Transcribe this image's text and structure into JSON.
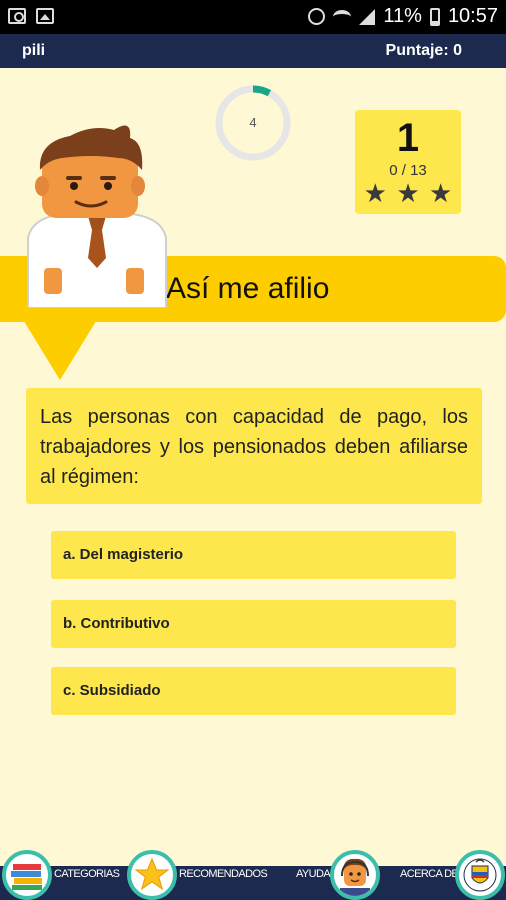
{
  "status_bar": {
    "battery": "11%",
    "time": "10:57"
  },
  "app_bar": {
    "user": "pili",
    "score": "Puntaje: 0"
  },
  "timer": {
    "value": "4",
    "progress": 0.08,
    "color": "#1aa58a",
    "track_color": "#e6e6e6"
  },
  "level": {
    "number": "1",
    "progress": "0 / 13",
    "stars": [
      "★",
      "★",
      "★"
    ]
  },
  "banner": {
    "title": "Así me afilio"
  },
  "question": {
    "text": "Las personas con capacidad de pago, los trabajadores y los pensionados deben afiliarse al régimen:"
  },
  "answers": [
    {
      "label": "a. Del magisterio"
    },
    {
      "label": "b. Contributivo"
    },
    {
      "label": "c. Subsidiado"
    }
  ],
  "nav": [
    {
      "label": "CATEGORIAS",
      "icon": "books-icon"
    },
    {
      "label": "RECOMENDADOS",
      "icon": "star-icon"
    },
    {
      "label": "AYUDA",
      "icon": "support-agent-icon"
    },
    {
      "label": "ACERCA DE",
      "icon": "coat-of-arms-icon"
    }
  ],
  "colors": {
    "background": "#fff8d4",
    "navy": "#1c2a4f",
    "yellow": "#fde74c",
    "banner": "#fecd00",
    "teal": "#3bbfaa"
  }
}
